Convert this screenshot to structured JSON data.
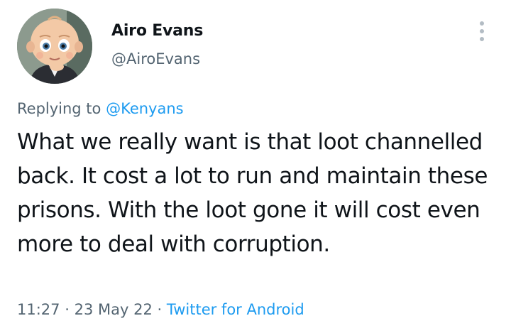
{
  "author": {
    "name": "Airo Evans",
    "handle": "@AiroEvans",
    "avatar_icon": "baby-cartoon-avatar"
  },
  "reply": {
    "prefix": "Replying to",
    "to": "@Kenyans"
  },
  "tweet": {
    "text": "What we really want is that loot channelled back. It cost a lot to run and maintain these prisons. With the loot gone it will cost even more to deal with corruption."
  },
  "meta": {
    "time": "11:27",
    "sep1": "·",
    "date": "23 May 22",
    "sep2": "·",
    "source": "Twitter for Android"
  },
  "colors": {
    "text": "#0f1419",
    "secondary": "#536471",
    "link": "#1d9bf0"
  },
  "icons": {
    "more": "more-vertical-icon"
  }
}
